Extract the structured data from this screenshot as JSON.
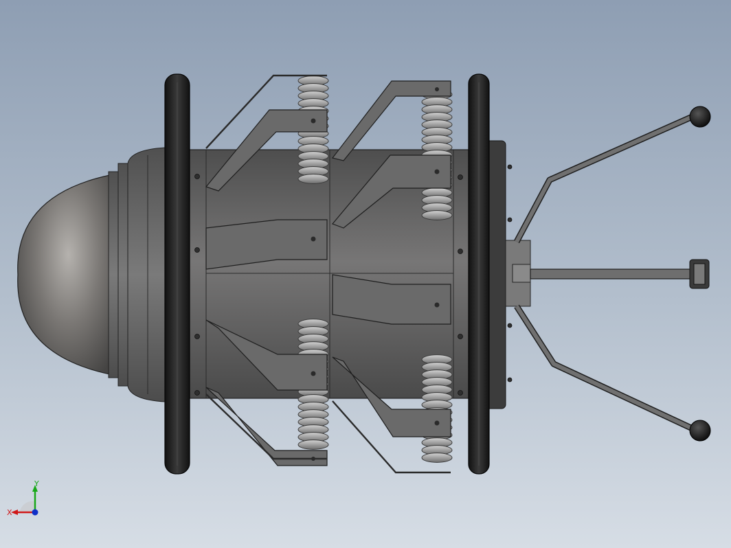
{
  "viewport": {
    "background_top": "#8e9eb3",
    "background_bottom": "#d6dde5"
  },
  "model": {
    "body_color": "#5f5f5f",
    "tire_color": "#1e1e1e",
    "spring_color": "#9a9a9a"
  },
  "triad": {
    "x_label": "X",
    "y_label": "Y",
    "x_color": "#d01818",
    "y_color": "#18a818",
    "z_color": "#1030c8"
  }
}
